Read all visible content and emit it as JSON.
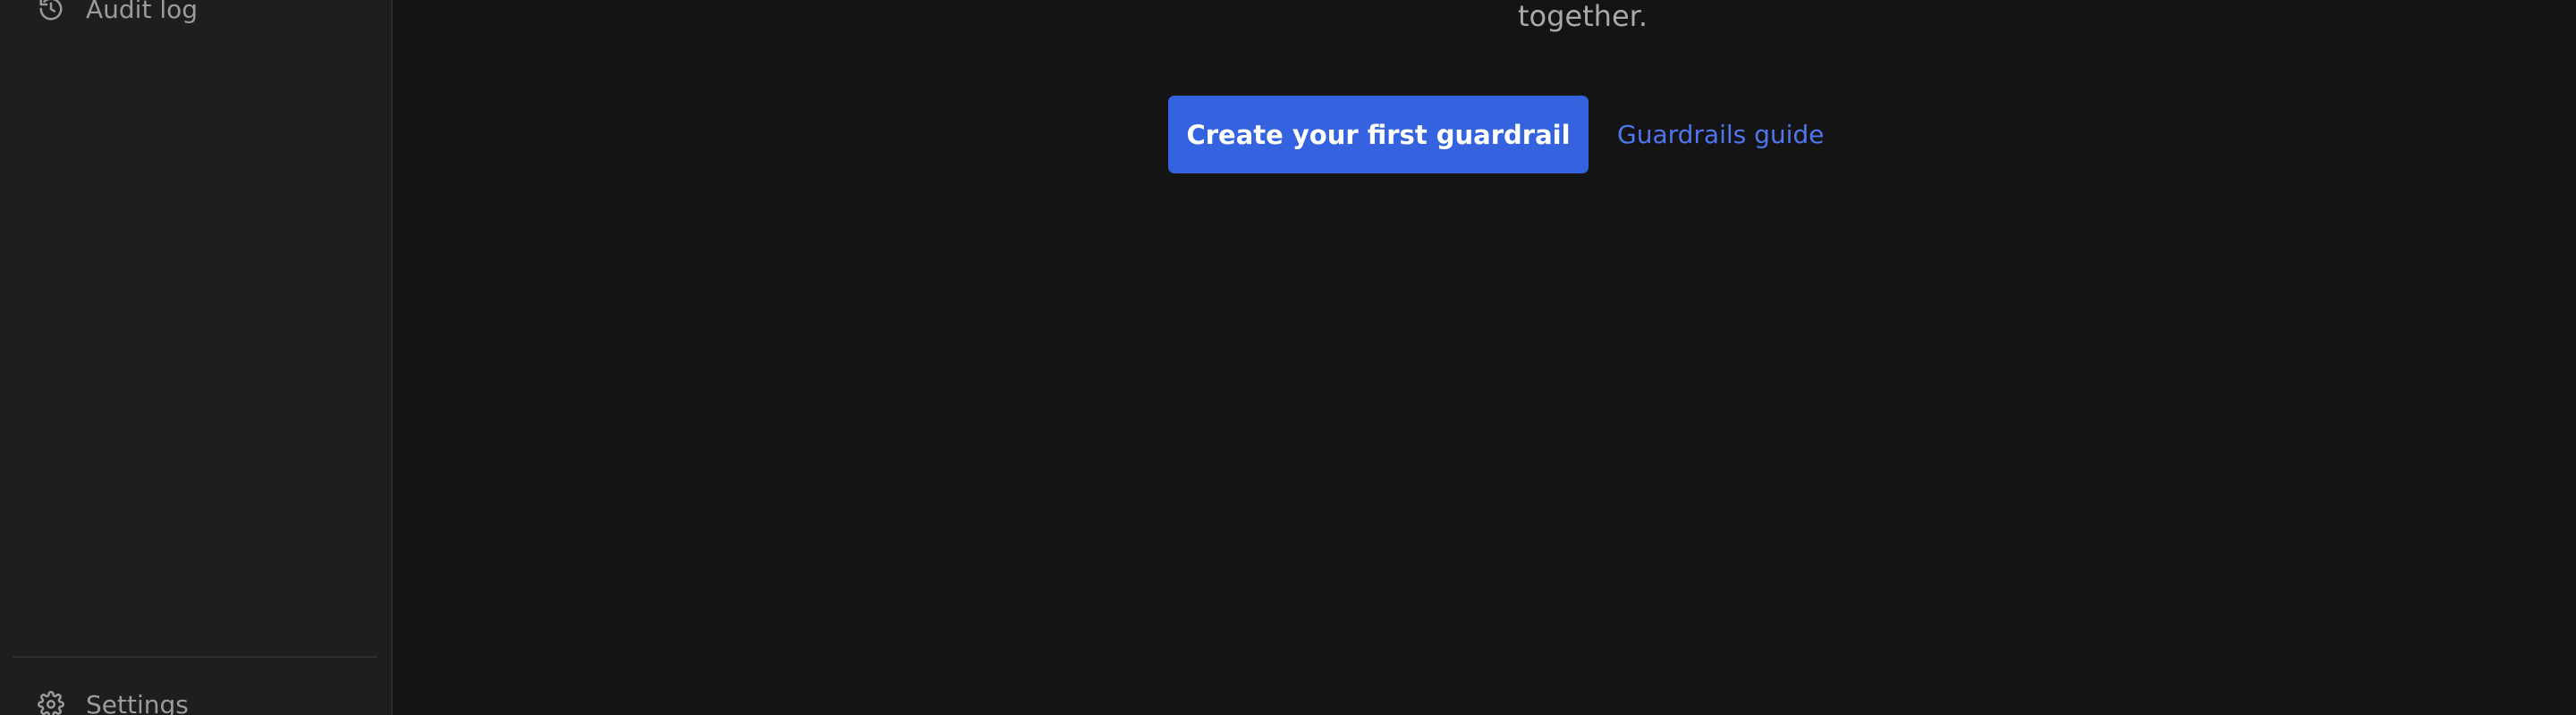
{
  "sidebar": {
    "items": [
      {
        "label": "Audit log",
        "icon": "history-icon"
      }
    ],
    "footer": {
      "label": "Settings",
      "icon": "gear-icon"
    }
  },
  "main": {
    "subtitle": "together.",
    "primary_button_label": "Create your first guardrail",
    "guide_link_label": "Guardrails guide"
  },
  "colors": {
    "accent": "#3563e0",
    "link": "#4f76ee",
    "background": "#141414",
    "sidebar": "#1e1e1e"
  }
}
